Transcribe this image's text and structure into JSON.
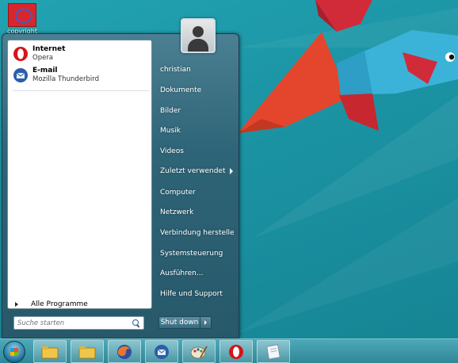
{
  "desktop": {
    "icon_label": "copyright"
  },
  "start_menu": {
    "pinned": [
      {
        "title": "Internet",
        "subtitle": "Opera",
        "icon": "opera-icon"
      },
      {
        "title": "E-mail",
        "subtitle": "Mozilla Thunderbird",
        "icon": "thunderbird-icon"
      }
    ],
    "all_programs": "Alle Programme",
    "search_placeholder": "Suche starten",
    "right_items": [
      "christian",
      "Dokumente",
      "Bilder",
      "Musik",
      "Videos",
      "Zuletzt verwendet",
      "Computer",
      "Netzwerk",
      "Verbindung herstelle",
      "Systemsteuerung",
      "Ausführen...",
      "Hilfe und Support"
    ],
    "shutdown_label": "Shut down"
  },
  "taskbar": {
    "buttons": [
      "explorer-icon",
      "explorer-icon",
      "firefox-icon",
      "thunderbird-icon",
      "paint-icon",
      "opera-icon",
      "notepad-icon"
    ]
  },
  "colors": {
    "wallpaper": "#1b93a3",
    "fish_blue": "#3bb3d8",
    "fish_red": "#d12b3a",
    "fin_orange": "#e4462d"
  }
}
